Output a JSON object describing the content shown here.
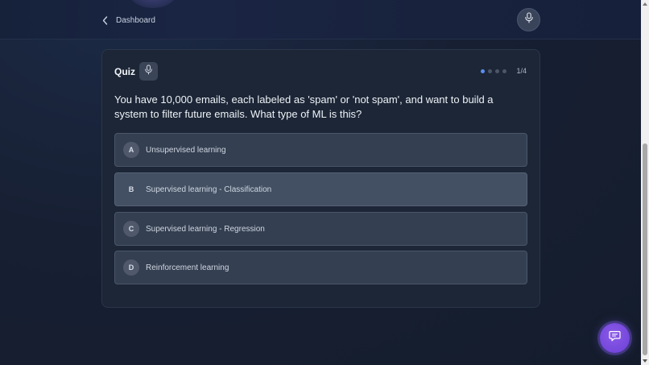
{
  "header": {
    "back_label": "Dashboard",
    "back_icon": "chevron-left-icon",
    "mic_icon": "microphone-icon"
  },
  "quiz": {
    "title": "Quiz",
    "mic_icon": "microphone-icon",
    "progress": {
      "current": 1,
      "total": 4,
      "text": "1/4"
    },
    "question": "You have 10,000 emails, each labeled as 'spam' or 'not spam', and want to build a system to filter future emails. What type of ML is this?",
    "options": [
      {
        "letter": "A",
        "text": "Unsupervised learning",
        "selected": false
      },
      {
        "letter": "B",
        "text": "Supervised learning - Classification",
        "selected": true
      },
      {
        "letter": "C",
        "text": "Supervised learning - Regression",
        "selected": false
      },
      {
        "letter": "D",
        "text": "Reinforcement learning",
        "selected": false
      }
    ]
  },
  "chat_fab": {
    "icon": "chat-bubble-icon"
  },
  "colors": {
    "background": "#172030",
    "card": "#1c2636",
    "option": "#343f51",
    "option_selected": "#435063",
    "accent_dot": "#5b8ff0",
    "chat_fab": "#7b4fe0"
  }
}
